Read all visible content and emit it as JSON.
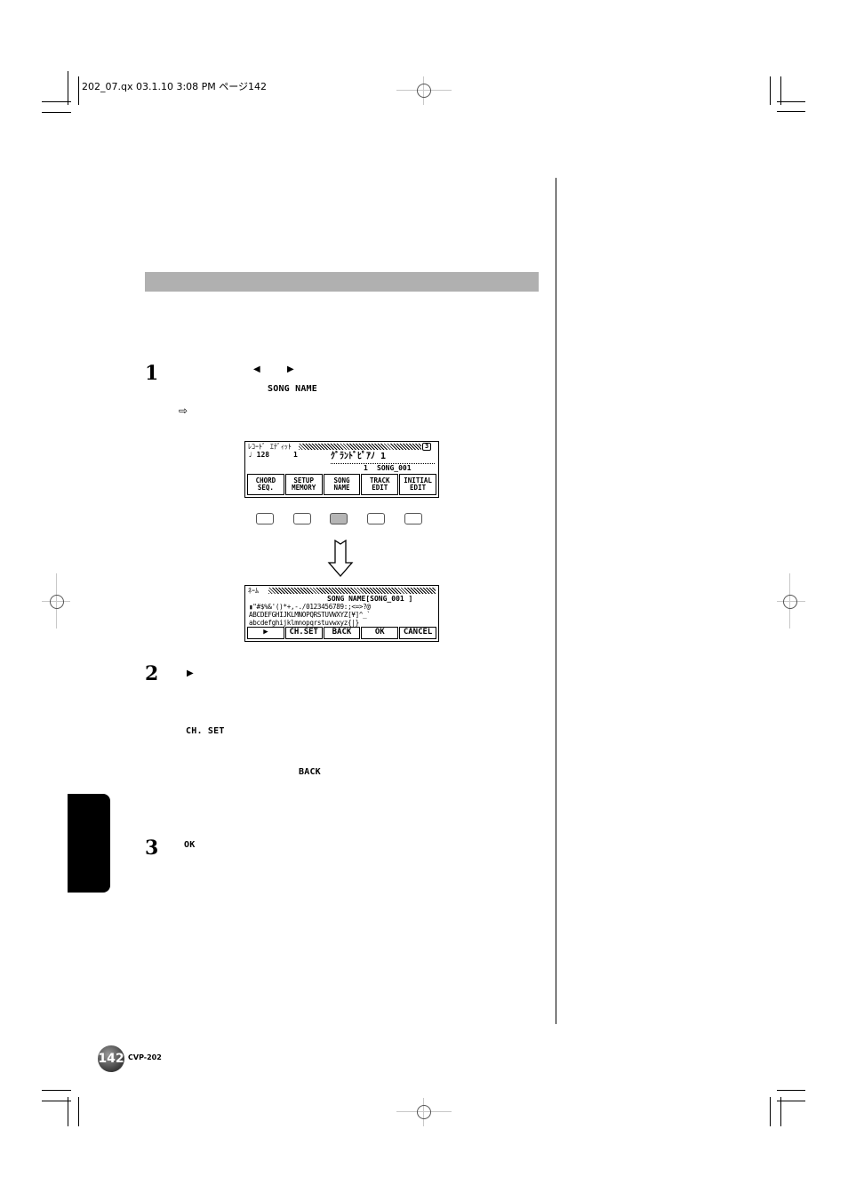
{
  "print_header": {
    "slug": "202_07.qx  03.1.10  3:08 PM    ページ142"
  },
  "step1": {
    "number": "1",
    "left_arrow_icon": "◀",
    "right_arrow_icon": "▶",
    "target_label": "SONG NAME",
    "ref_arrow_icon": "⇨"
  },
  "screen1": {
    "title": "ﾚｺｰﾄﾞ ｴﾃﾞｨｯﾄ",
    "page_indicator": "3",
    "tempo_label": "♩ 128",
    "measure_label": "1",
    "voice_name": "ｸﾞﾗﾝﾄﾞﾋﾟｱﾉ 1",
    "song_number": "1",
    "song_name": "SONG_001",
    "buttons": [
      {
        "line1": "CHORD",
        "line2": "SEQ."
      },
      {
        "line1": "SETUP",
        "line2": "MEMORY"
      },
      {
        "line1": "SONG",
        "line2": "NAME"
      },
      {
        "line1": "TRACK",
        "line2": "EDIT"
      },
      {
        "line1": "INITIAL",
        "line2": "EDIT"
      }
    ]
  },
  "panel_buttons": {
    "active_index": 2,
    "count": 5
  },
  "down_arrow_icon": "⇩",
  "screen2": {
    "title": "ﾈｰﾑ",
    "name_field": "SONG NAME[SONG_001      ]",
    "char_row1": "▮\"#$%&'()*+,-./0123456789:;<=>?@",
    "char_row2": "ABCDEFGHIJKLMNOPQRSTUVWXYZ[¥]^_`",
    "char_row3": "abcdefghijklmnopqrstuvwxyz{|}",
    "buttons": [
      "▶",
      "CH.SET",
      "BACK",
      "OK",
      "CANCEL"
    ]
  },
  "step2": {
    "number": "2",
    "arrow_icon": "▶",
    "chset_label": "CH. SET",
    "back_label": "BACK"
  },
  "step3": {
    "number": "3",
    "ok_label": "OK"
  },
  "footer": {
    "page_number": "142",
    "model": "CVP-202"
  }
}
